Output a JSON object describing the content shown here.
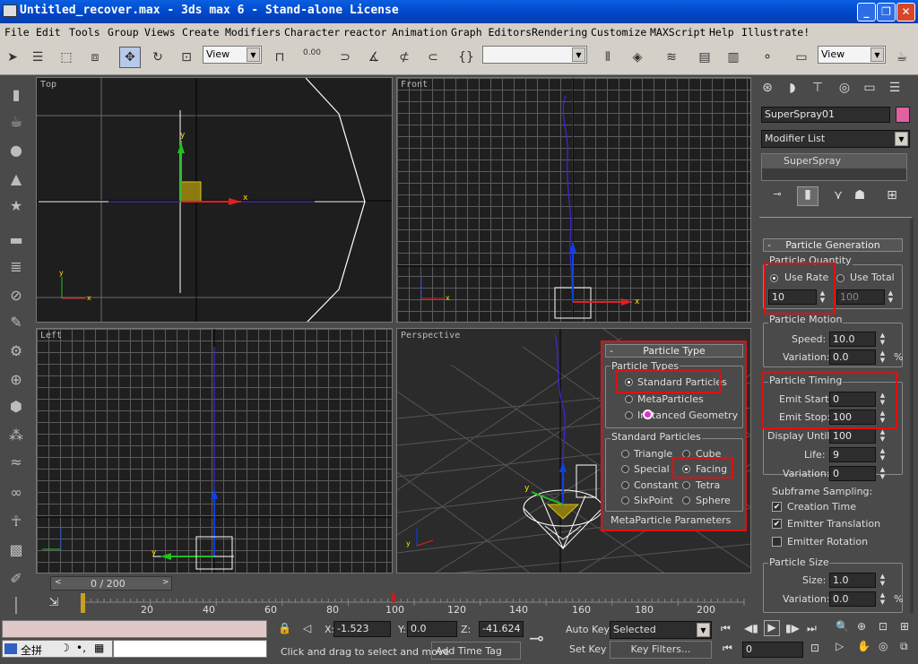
{
  "window": {
    "title": "Untitled_recover.max - 3ds max 6 - Stand-alone License"
  },
  "menu": [
    "File",
    "Edit",
    "Tools",
    "Group",
    "Views",
    "Create",
    "Modifiers",
    "Character",
    "reactor",
    "Animation",
    "Graph Editors",
    "Rendering",
    "Customize",
    "MAXScript",
    "Help",
    "Illustrate!"
  ],
  "toolbar": {
    "view_combo_1": "View",
    "view_combo_2": "View",
    "spinner_value": "0.00"
  },
  "viewports": {
    "top": "Top",
    "front": "Front",
    "left": "Left",
    "perspective": "Perspective"
  },
  "axis": {
    "x": "x",
    "y": "y"
  },
  "command_panel": {
    "object_name": "SuperSpray01",
    "object_color": "#e060a0",
    "modifier_list": "Modifier List",
    "stack_item": "SuperSpray",
    "rollout_particle_generation": "Particle Generation",
    "particle_quantity": "Particle Quantity",
    "use_rate": "Use Rate",
    "use_total": "Use Total",
    "rate_value": "10",
    "total_value": "100",
    "particle_motion": "Particle Motion",
    "speed_label": "Speed:",
    "speed_value": "10.0",
    "variation_label": "Variation:",
    "variation_value": "0.0",
    "percent": "%",
    "particle_timing": "Particle Timing",
    "emit_start_label": "Emit Start:",
    "emit_start_value": "0",
    "emit_stop_label": "Emit Stop:",
    "emit_stop_value": "100",
    "display_until_label": "Display Until:",
    "display_until_value": "100",
    "life_label": "Life:",
    "life_value": "9",
    "life_variation_value": "0",
    "subframe_sampling": "Subframe Sampling:",
    "creation_time": "Creation Time",
    "emitter_translation": "Emitter Translation",
    "emitter_rotation": "Emitter Rotation",
    "particle_size": "Particle Size",
    "size_label": "Size:",
    "size_value": "1.0",
    "size_variation_value": "0.0"
  },
  "particle_type_popup": {
    "header": "Particle Type",
    "particle_types": "Particle Types",
    "standard_particles": "Standard Particles",
    "metaparticles": "MetaParticles",
    "instanced_geometry": "Instanced Geometry",
    "standard_group": "Standard Particles",
    "triangle": "Triangle",
    "cube": "Cube",
    "special": "Special",
    "facing": "Facing",
    "constant": "Constant",
    "tetra": "Tetra",
    "sixpoint": "SixPoint",
    "sphere": "Sphere",
    "metaparticle_parameters": "MetaParticle Parameters"
  },
  "timeline": {
    "frame_counter": "0 / 200",
    "ticks": [
      "20",
      "40",
      "60",
      "80",
      "100",
      "120",
      "140",
      "160",
      "180",
      "200"
    ]
  },
  "status": {
    "x_label": "X:",
    "x_value": "-1.523",
    "y_label": "Y:",
    "y_value": "0.0",
    "z_label": "Z:",
    "z_value": "-41.624",
    "prompt": "Click and drag to select and move",
    "add_time_tag": "Add Time Tag",
    "auto_key": "Auto Key",
    "set_key": "Set Key",
    "selected": "Selected",
    "key_filters": "Key Filters...",
    "frame_value": "0",
    "ime_text": "全拼"
  }
}
